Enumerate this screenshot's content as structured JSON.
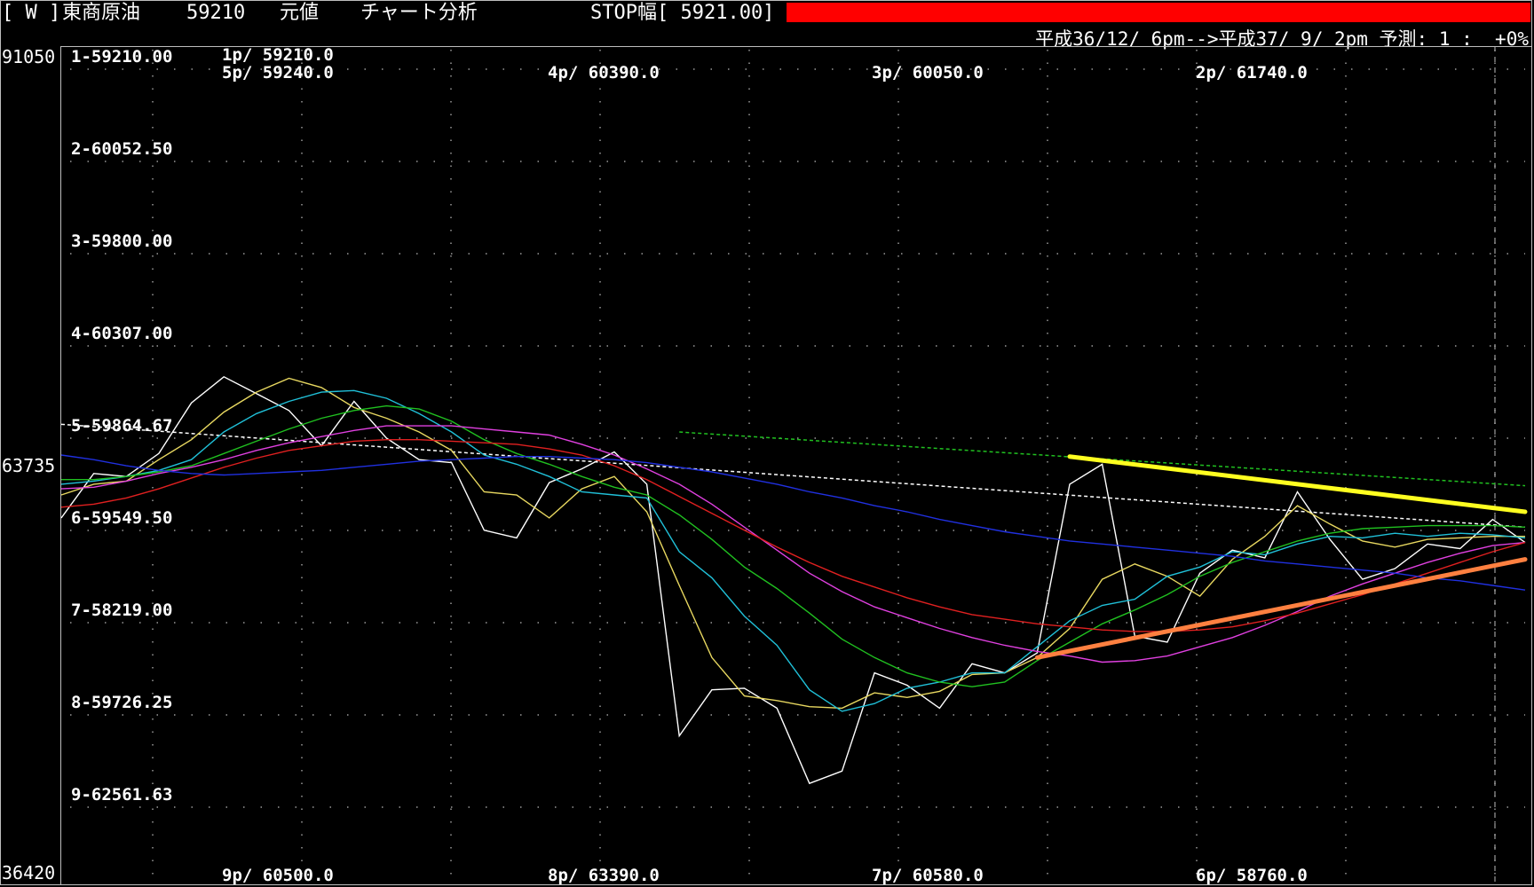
{
  "header": {
    "mode": "[ W ]",
    "instrument": "東商原油",
    "price": "59210",
    "price_type": "元値",
    "analysis": "チャート分析",
    "stop_width": "STOP幅[ 5921.00]",
    "forecast": "平成36/12/ 6pm-->平成37/ 9/ 2pm 予測: 1 :  +0%"
  },
  "yaxis": {
    "top": "91050",
    "mid": "63735",
    "bottom": "36420"
  },
  "colors": {
    "white": "#ffffff",
    "yellow": "#e8d860",
    "cyan": "#20c0d8",
    "green": "#20c020",
    "magenta": "#e040e0",
    "red": "#e02020",
    "blue": "#2030e0",
    "trend_upper": "#ffff20",
    "trend_lower": "#ff8040",
    "red_bar": "#ff0000"
  },
  "chart_data": {
    "type": "line",
    "ylim": [
      36420,
      91050
    ],
    "mid_value": 63735,
    "level_labels": [
      "1-59210.00",
      "2-60052.50",
      "3-59800.00",
      "4-60307.00",
      "5-59864.67",
      "6-59549.50",
      "7-58219.00",
      "8-59726.25",
      "9-62561.63"
    ],
    "top_labels": [
      "1p/ 59210.0",
      "5p/ 59240.0",
      "4p/ 60390.0",
      "3p/ 60050.0",
      "2p/ 61740.0"
    ],
    "bottom_labels": [
      "9p/ 60500.0",
      "8p/ 63390.0",
      "7p/ 60580.0",
      "6p/ 58760.0"
    ],
    "x_count": 46,
    "series": [
      {
        "color": "white",
        "values": [
          60300,
          63200,
          63000,
          64500,
          67800,
          69500,
          68400,
          67300,
          65000,
          67900,
          65500,
          64100,
          63900,
          59500,
          59000,
          62600,
          63500,
          64600,
          62500,
          46100,
          49100,
          49200,
          47900,
          43000,
          43800,
          50200,
          49400,
          47900,
          50800,
          50200,
          51500,
          62500,
          63800,
          52600,
          52200,
          56700,
          58200,
          57700,
          62000,
          58900,
          56300,
          57000,
          58600,
          58300,
          60200,
          58700
        ]
      },
      {
        "color": "yellow",
        "values": [
          61800,
          62500,
          62700,
          64100,
          65400,
          67200,
          68500,
          69400,
          68800,
          67500,
          66800,
          65900,
          64700,
          62000,
          61800,
          60300,
          62200,
          63000,
          60700,
          55900,
          51200,
          48700,
          48400,
          48000,
          47900,
          48900,
          48600,
          49000,
          50100,
          50200,
          51200,
          53100,
          56300,
          57300,
          56500,
          55200,
          57600,
          59100,
          61100,
          59900,
          58800,
          58400,
          58900,
          59000,
          59100,
          59100
        ]
      },
      {
        "color": "cyan",
        "values": [
          62500,
          62700,
          63000,
          63400,
          64100,
          65900,
          67100,
          67900,
          68500,
          68600,
          68100,
          67100,
          65900,
          64400,
          63800,
          63000,
          62000,
          61800,
          61600,
          58100,
          56400,
          53900,
          52000,
          49100,
          47700,
          48200,
          49200,
          49600,
          50200,
          50200,
          51900,
          53600,
          54600,
          55000,
          56500,
          57100,
          58100,
          57900,
          58600,
          59100,
          59000,
          59300,
          59100,
          59300,
          59200,
          59000
        ]
      },
      {
        "color": "green",
        "values": [
          62800,
          62800,
          63000,
          63300,
          63700,
          64500,
          65300,
          66100,
          66800,
          67300,
          67600,
          67400,
          66600,
          65400,
          64500,
          63800,
          63000,
          62300,
          61800,
          60500,
          58900,
          57100,
          55700,
          54100,
          52400,
          51200,
          50200,
          49600,
          49300,
          49600,
          51000,
          52200,
          53400,
          54300,
          55300,
          56500,
          57400,
          58100,
          58800,
          59300,
          59600,
          59700,
          59800,
          59800,
          59800,
          59700
        ]
      },
      {
        "color": "magenta",
        "values": [
          62200,
          62300,
          62700,
          63200,
          63600,
          64100,
          64700,
          65200,
          65600,
          66000,
          66300,
          66300,
          66300,
          66100,
          65900,
          65700,
          65100,
          64400,
          63500,
          62500,
          61200,
          59700,
          58200,
          56700,
          55500,
          54500,
          53800,
          53100,
          52500,
          52000,
          51600,
          51300,
          50900,
          51000,
          51300,
          51900,
          52500,
          53300,
          54200,
          55200,
          56000,
          56700,
          57400,
          58000,
          58500,
          58700
        ]
      },
      {
        "color": "red",
        "values": [
          61000,
          61200,
          61600,
          62200,
          62900,
          63600,
          64200,
          64700,
          65000,
          65300,
          65400,
          65400,
          65300,
          65200,
          65100,
          64800,
          64400,
          63700,
          62800,
          61700,
          60600,
          59500,
          58400,
          57400,
          56500,
          55800,
          55100,
          54500,
          54000,
          53700,
          53400,
          53200,
          53000,
          52900,
          52900,
          53000,
          53200,
          53600,
          54100,
          54700,
          55300,
          56000,
          56700,
          57400,
          58100,
          58700
        ]
      },
      {
        "color": "blue",
        "values": [
          64400,
          64100,
          63700,
          63400,
          63200,
          63100,
          63200,
          63300,
          63400,
          63600,
          63800,
          64000,
          64100,
          64200,
          64300,
          64300,
          64200,
          64100,
          63900,
          63600,
          63300,
          62900,
          62500,
          62000,
          61600,
          61100,
          60700,
          60200,
          59800,
          59400,
          59100,
          58800,
          58600,
          58400,
          58200,
          58000,
          57800,
          57500,
          57300,
          57100,
          56900,
          56700,
          56400,
          56200,
          55900,
          55600
        ]
      }
    ],
    "dashed_lines": [
      {
        "color": "white",
        "start": [
          0,
          66400
        ],
        "end": [
          45,
          59700
        ]
      },
      {
        "color": "green",
        "start": [
          19,
          65900
        ],
        "end": [
          45,
          62400
        ]
      }
    ],
    "trend_lines": [
      {
        "color": "trend_upper",
        "start": [
          31,
          64300
        ],
        "end": [
          45,
          60700
        ]
      },
      {
        "color": "trend_lower",
        "start": [
          30,
          51200
        ],
        "end": [
          45,
          57600
        ]
      }
    ]
  }
}
